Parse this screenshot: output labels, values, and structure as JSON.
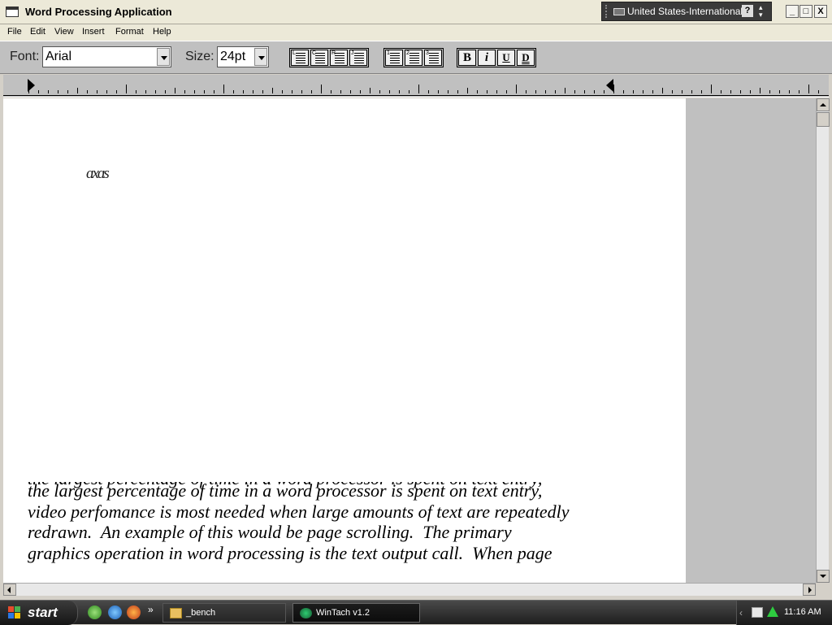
{
  "window": {
    "title": "Word Processing Application",
    "buttons": {
      "minimize": "_",
      "maximize": "□",
      "close": "X"
    }
  },
  "language_bar": {
    "language": "United States-International",
    "help": "?"
  },
  "menu": {
    "items": [
      "File",
      "Edit",
      "View",
      "Insert",
      "Format",
      "Help"
    ]
  },
  "toolbar": {
    "font_label": "Font:",
    "font_value": "Arial",
    "size_label": "Size:",
    "size_value": "24pt",
    "align_buttons": [
      "align-left",
      "align-center",
      "align-right",
      "justify"
    ],
    "list_buttons": [
      "list-1",
      "list-2",
      "list-3"
    ],
    "style_buttons": {
      "bold": "B",
      "italic": "i",
      "underline": "U",
      "double_underline": "D"
    }
  },
  "document": {
    "glyph": "ɑxɑs",
    "partial_line": "the largest percentage of time in a word processor is spent on text entry,",
    "lines": [
      "the largest percentage of time in a word processor is spent on text entry,",
      "video perfomance is most needed when large amounts of text are repeatedly",
      "redrawn.  An example of this would be page scrolling.  The primary",
      "graphics operation in word processing is the text output call.  When page"
    ]
  },
  "taskbar": {
    "start_label": "start",
    "more": "»",
    "tasks": [
      {
        "label": "_bench",
        "icon": "folder-icon"
      },
      {
        "label": "WinTach v1.2",
        "icon": "wintach-icon"
      }
    ],
    "clock": "11:16 AM"
  },
  "colors": {
    "taskbar": "#1e1e1e",
    "toolbar": "#c0c0c0",
    "page": "#ffffff"
  }
}
